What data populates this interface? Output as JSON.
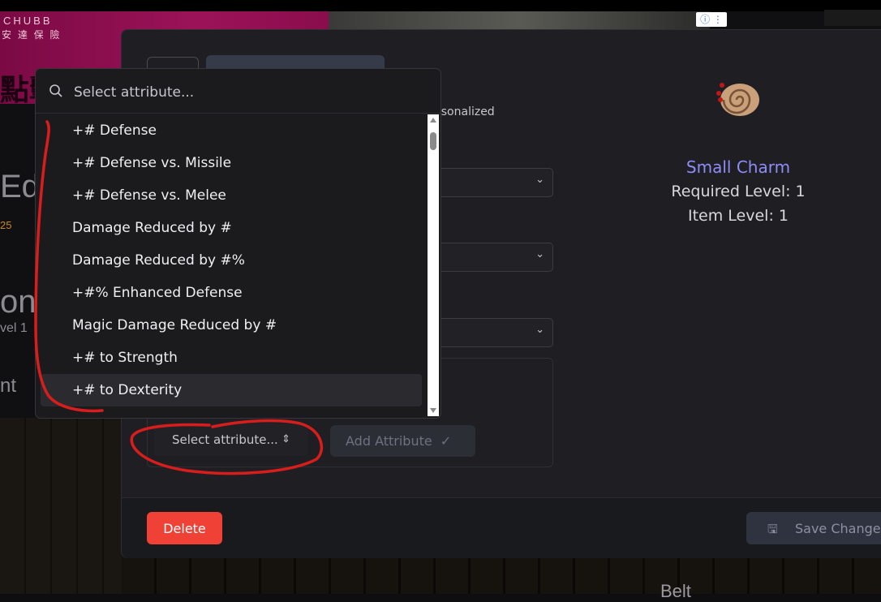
{
  "background": {
    "ad_logo": "CHUBB",
    "ad_sub": "安 達 保 險",
    "ad_big": "點擊",
    "adchoice": "ⓘ ⋮",
    "left_texts": [
      "Ed",
      "25",
      "on",
      "vel 1",
      "nt"
    ],
    "bottom_text": "Belt"
  },
  "modal": {
    "personalized_text": "rsonalized",
    "select_attribute_label": "Select attribute...",
    "add_attribute_label": "Add Attribute",
    "delete_label": "Delete",
    "save_label": "Save Changes"
  },
  "item": {
    "name": "Small Charm",
    "required_level": "Required Level: 1",
    "item_level": "Item Level: 1",
    "name_color": "#8e8cf6"
  },
  "dropdown": {
    "search_placeholder": "Select attribute...",
    "items": [
      "+# Defense",
      "+# Defense vs. Missile",
      "+# Defense vs. Melee",
      "Damage Reduced by #",
      "Damage Reduced by #%",
      "+#% Enhanced Defense",
      "Magic Damage Reduced by #",
      "+# to Strength",
      "+# to Dexterity"
    ],
    "active_index": 8
  },
  "colors": {
    "delete": "#ef4136",
    "annotation": "#d81d1d"
  }
}
